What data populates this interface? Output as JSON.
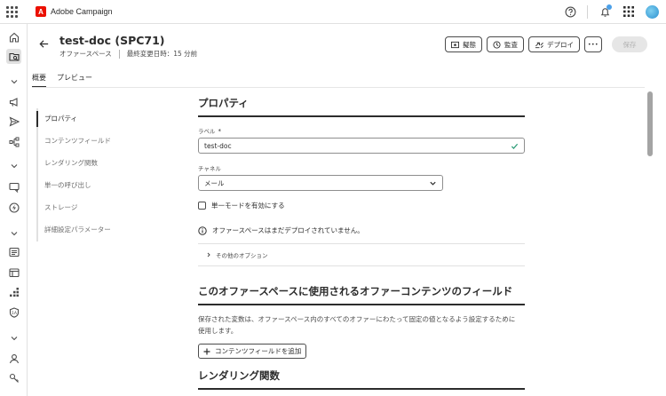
{
  "app": {
    "name": "Adobe Campaign",
    "logo_letter": "A"
  },
  "header": {
    "title": "test-doc (SPC71)",
    "subtitle": "オファースペース",
    "modified": "最終変更日時：15 分前"
  },
  "actions": {
    "simulate": "擬態",
    "audit": "監査",
    "deploy": "デプロイ",
    "more": "•••",
    "save": "保存"
  },
  "tabs": [
    {
      "label": "概要",
      "active": true
    },
    {
      "label": "プレビュー",
      "active": false
    }
  ],
  "section_nav": [
    {
      "label": "プロパティ",
      "active": true
    },
    {
      "label": "コンテンツフィールド",
      "active": false
    },
    {
      "label": "レンダリング関数",
      "active": false
    },
    {
      "label": "単一の呼び出し",
      "active": false
    },
    {
      "label": "ストレージ",
      "active": false
    },
    {
      "label": "詳細設定パラメーター",
      "active": false
    }
  ],
  "properties": {
    "heading": "プロパティ",
    "label_field": {
      "label": "ラベル",
      "required_mark": "*",
      "value": "test-doc"
    },
    "channel_field": {
      "label": "チャネル",
      "value": "メール"
    },
    "single_mode_label": "単一モードを有効にする",
    "info_text": "オファースペースはまだデプロイされていません。",
    "other_options": "その他のオプション"
  },
  "content_fields": {
    "heading": "このオファースペースに使用されるオファーコンテンツのフィールド",
    "description": "保存された変数は、オファースペース内のすべてのオファーにわたって固定の値となるよう設定するために使用します。",
    "add_button": "コンテンツフィールドを追加"
  },
  "rendering": {
    "heading": "レンダリング関数"
  },
  "colors": {
    "brand": "#eb1000",
    "notification": "#4a9fe8",
    "valid_check": "#2d9d78",
    "save_disabled": "#e6e6e6"
  },
  "rail_icons": [
    "home-icon",
    "explorer-icon",
    "chevron-down-icon",
    "campaign-icon",
    "send-icon",
    "journey-icon",
    "chevron-down-icon",
    "reports-icon",
    "offer-icon",
    "chevron-down-icon",
    "list-icon",
    "template-icon",
    "hierarchy-icon",
    "audit-icon",
    "chevron-down-icon",
    "user-icon",
    "key-icon"
  ]
}
